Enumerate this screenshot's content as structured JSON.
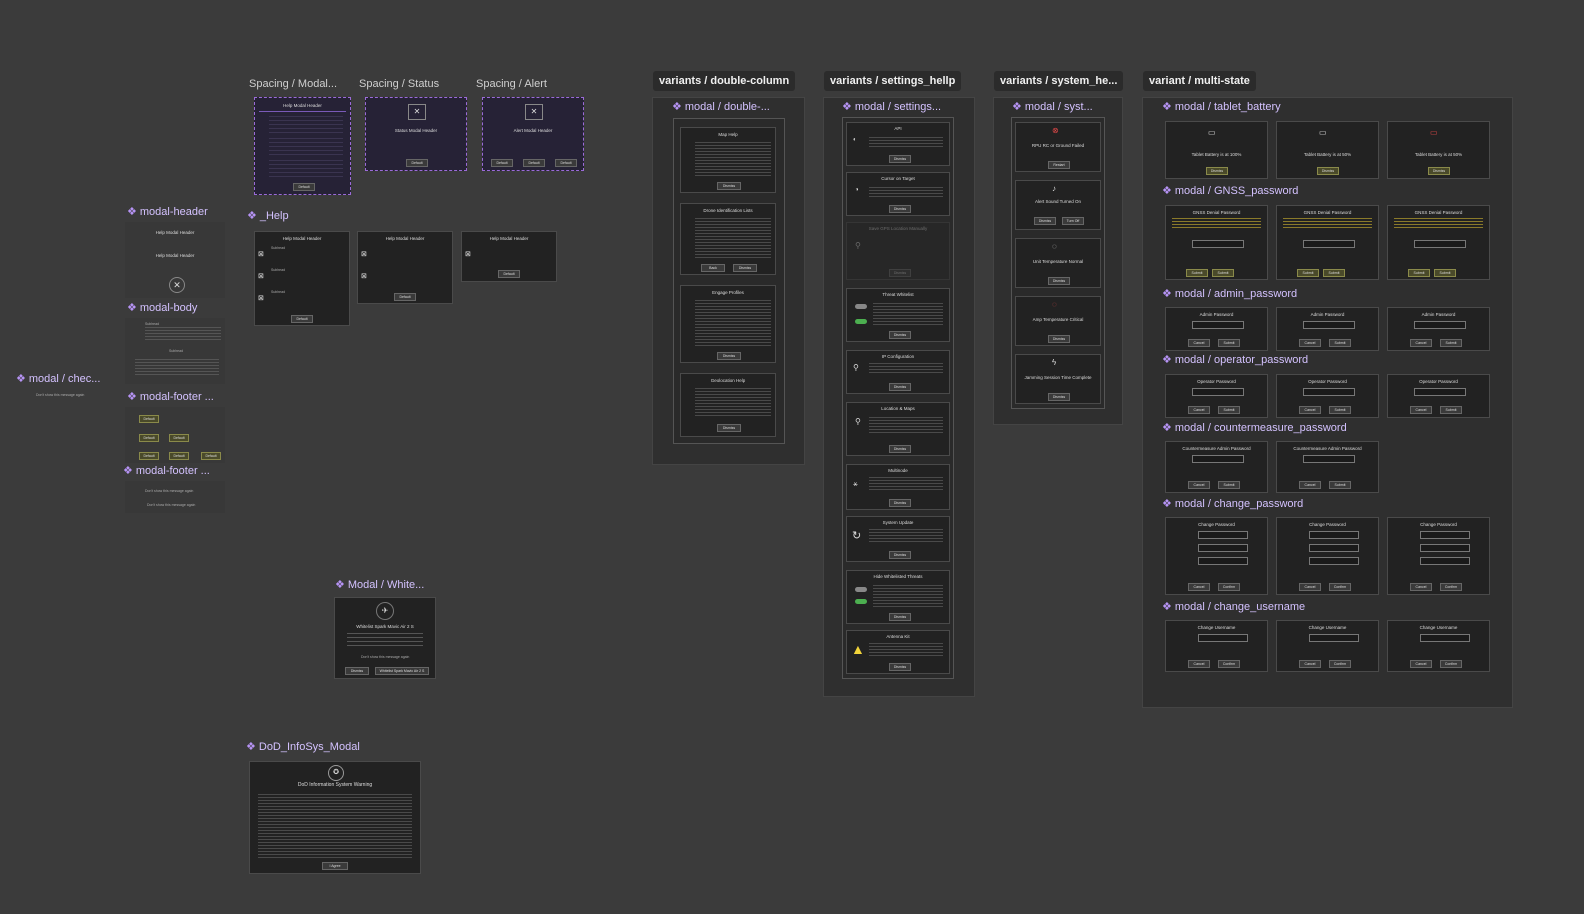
{
  "spacing_labels": [
    "Spacing / Modal...",
    "Spacing / Status",
    "Spacing / Alert"
  ],
  "left_components": {
    "header": "modal-header",
    "header_texts": [
      "Help Modal Header",
      "Help Modal Header"
    ],
    "body": "modal-body",
    "body_texts": [
      "Subhead",
      "Subhead"
    ],
    "footer": "modal-footer ...",
    "footer2": "modal-footer ...",
    "footer_buttons": [
      "Default",
      "Default",
      "Default",
      "Default",
      "Default",
      "Default"
    ],
    "check": "modal / chec...",
    "check_text": "Don't show this message again",
    "footer2_texts": [
      "Don't show this message again",
      "Don't show this message again"
    ]
  },
  "help": {
    "label": "_Help",
    "header": "Help Modal Header",
    "btn": "Default",
    "subheads": [
      "Subhead",
      "Subhead",
      "Subhead"
    ]
  },
  "spacing_modal": {
    "header": "Help Modal Header",
    "btn": "Default"
  },
  "spacing_status": {
    "header": "Status Modal Header",
    "btn": "Default"
  },
  "spacing_alert": {
    "header": "Alert Modal Header",
    "btns": [
      "Default",
      "Default",
      "Default"
    ]
  },
  "white": {
    "label": "Modal / White...",
    "title": "Whitelist Spark Mavic Air 2 S",
    "check": "Don't show this message again",
    "btns": [
      "Dismiss",
      "Whitelist Spark Mavic Air 2 S"
    ]
  },
  "dod": {
    "label": "DoD_InfoSys_Modal",
    "title": "DoD Information System Warning",
    "btn": "I Agree"
  },
  "variant_tabs": [
    "variants / double-column",
    "variants / settings_hellp",
    "variants / system_he...",
    "variant / multi-state"
  ],
  "double_column": {
    "label": "modal / double-...",
    "cards": [
      {
        "title": "Map Help",
        "btn": "Dismiss"
      },
      {
        "title": "Drone Identification Lists",
        "btns": [
          "Back",
          "Dismiss"
        ]
      },
      {
        "title": "Engage Profiles",
        "btn": "Dismiss"
      },
      {
        "title": "Geolocation Help",
        "btn": "Dismiss"
      }
    ]
  },
  "settings": {
    "label": "modal / settings...",
    "cards": [
      {
        "title": "API",
        "btn": "Dismiss"
      },
      {
        "title": "Cursor on Target",
        "btn": "Dismiss"
      },
      {
        "title": "Save GPS Location Manually",
        "btn": "Dismiss"
      },
      {
        "title": "Threat Whitelist",
        "btn": "Dismiss"
      },
      {
        "title": "IP Configuration",
        "btn": "Dismiss"
      },
      {
        "title": "Location & Maps",
        "btn": "Dismiss"
      },
      {
        "title": "Multinode",
        "btn": "Dismiss"
      },
      {
        "title": "System Update",
        "btn": "Dismiss"
      },
      {
        "title": "Hide Whitelisted Threats",
        "btn": "Dismiss"
      },
      {
        "title": "Antenna Kit",
        "btn": "Dismiss"
      }
    ]
  },
  "system": {
    "label": "modal / syst...",
    "cards": [
      {
        "title": "RPU RC or Ground Failed",
        "btns": [
          "Restart"
        ]
      },
      {
        "title": "Alert Sound Turned On",
        "btns": [
          "Dismiss",
          "Turn Off"
        ]
      },
      {
        "title": "Unit Temperature Normal",
        "btns": [
          "Dismiss"
        ]
      },
      {
        "title": "Amp Temperature Critical",
        "btns": [
          "Dismiss"
        ]
      },
      {
        "title": "Jamming Session Time Complete",
        "btns": [
          "Dismiss"
        ]
      }
    ]
  },
  "multi": {
    "tablet_label": "modal / tablet_battery",
    "tablet": [
      "Tablet Battery is at 100%",
      "Tablet Battery is at 50%",
      "Tablet Battery is at 50%"
    ],
    "tablet_btn": "Dismiss",
    "gnss_label": "modal / GNSS_password",
    "gnss_title": "GNSS Denial Password",
    "admin_label": "modal / admin_password",
    "admin_title": "Admin Password",
    "operator_label": "modal / operator_password",
    "operator_title": "Operator Password",
    "counter_label": "modal / countermeasure_password",
    "counter_title": "Countermeasure Admin Password",
    "change_pw_label": "modal / change_password",
    "change_pw_title": "Change Password",
    "change_user_label": "modal / change_username",
    "change_user_title": "Change Username",
    "btn_cancel": "Cancel",
    "btn_submit": "Submit",
    "btn_confirm": "Confirm"
  }
}
